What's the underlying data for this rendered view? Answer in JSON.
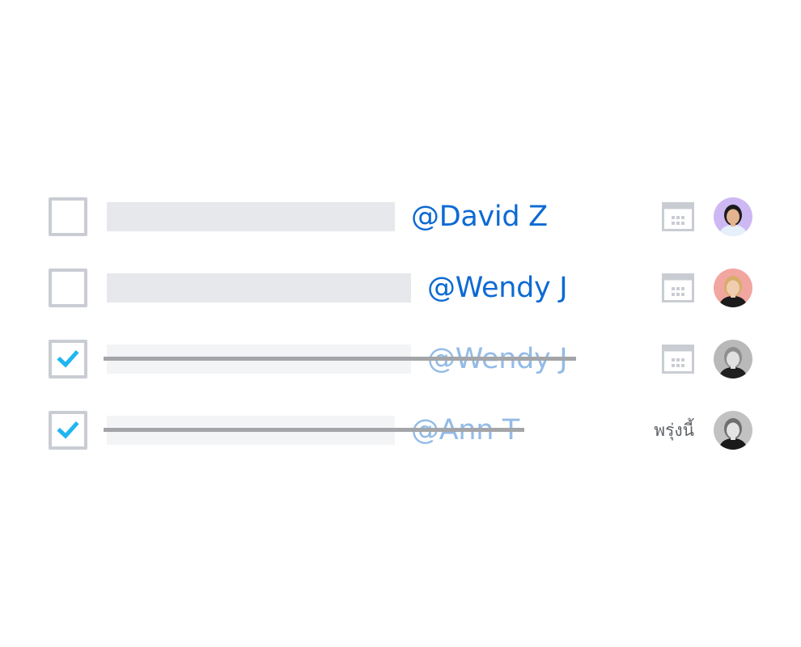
{
  "tasks": [
    {
      "mention": "@David Z",
      "completed": false,
      "due": null,
      "avatar": {
        "bg": "#cdb8f4",
        "hair": "#1b1b1b",
        "skin": "#e3b48f",
        "shirt": "#e6f0fa"
      }
    },
    {
      "mention": "@Wendy J",
      "completed": false,
      "due": null,
      "avatar": {
        "bg": "#f2a6a0",
        "hair": "#d8ad6a",
        "skin": "#f1cdb0",
        "shirt": "#1c1c1c"
      }
    },
    {
      "mention": "@Wendy J",
      "completed": true,
      "due": null,
      "avatar": {
        "bg": "#b9b9b9",
        "hair": "#8e8e8e",
        "skin": "#e0e0e0",
        "shirt": "#202020"
      }
    },
    {
      "mention": "@Ann T",
      "completed": true,
      "due": "พรุ่งนี้",
      "avatar": {
        "bg": "#c2c2c2",
        "hair": "#6f6f6f",
        "skin": "#e4e4e4",
        "shirt": "#1a1a1a"
      }
    }
  ],
  "icons": {
    "checkmark": "check-icon",
    "calendar": "calendar-icon"
  },
  "colors": {
    "checkbox_border": "#c9cdd3",
    "check": "#1fb6f1",
    "mention": "#0d6ad3",
    "mention_done": "#93bbe6",
    "strike": "#a3a5a8",
    "placeholder": "#e7e8eb",
    "calendar": "#c9cdd3"
  }
}
